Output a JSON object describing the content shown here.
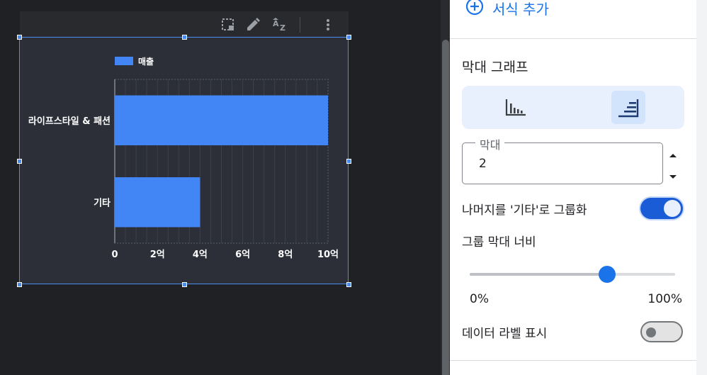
{
  "toolbar": {
    "icons": [
      "select-region-icon",
      "pencil-icon",
      "sort-az-icon",
      "more-vert-icon"
    ]
  },
  "chart_data": {
    "type": "bar",
    "orientation": "horizontal",
    "categories": [
      "라이프스타일 & 패션",
      "기타"
    ],
    "series": [
      {
        "name": "매출",
        "values": [
          10,
          4
        ]
      }
    ],
    "xlim": [
      0,
      10
    ],
    "x_ticks": [
      {
        "value": 0,
        "label": "0"
      },
      {
        "value": 2,
        "label": "2억"
      },
      {
        "value": 4,
        "label": "4억"
      },
      {
        "value": 6,
        "label": "6억"
      },
      {
        "value": 8,
        "label": "8억"
      },
      {
        "value": 10,
        "label": "10억"
      }
    ],
    "legend_position": "top-left",
    "grid": true,
    "bar_color": "#4285f4"
  },
  "panel": {
    "add_format_label": "서식 추가",
    "bar_section_title": "막대 그래프",
    "orientation_options": [
      "vertical-bar-icon",
      "horizontal-bar-icon"
    ],
    "orientation_selected": "horizontal",
    "bars_field": {
      "label": "막대",
      "value": "2"
    },
    "group_others": {
      "label": "나머지를 '기타'로 그룹화",
      "enabled": true
    },
    "group_bar_width": {
      "label": "그룹 막대 너비",
      "value_percent": 67,
      "min_label": "0%",
      "max_label": "100%"
    },
    "show_data_labels": {
      "label": "데이터 라벨 표시",
      "enabled": false
    },
    "accent_color": "#1a73e8"
  }
}
